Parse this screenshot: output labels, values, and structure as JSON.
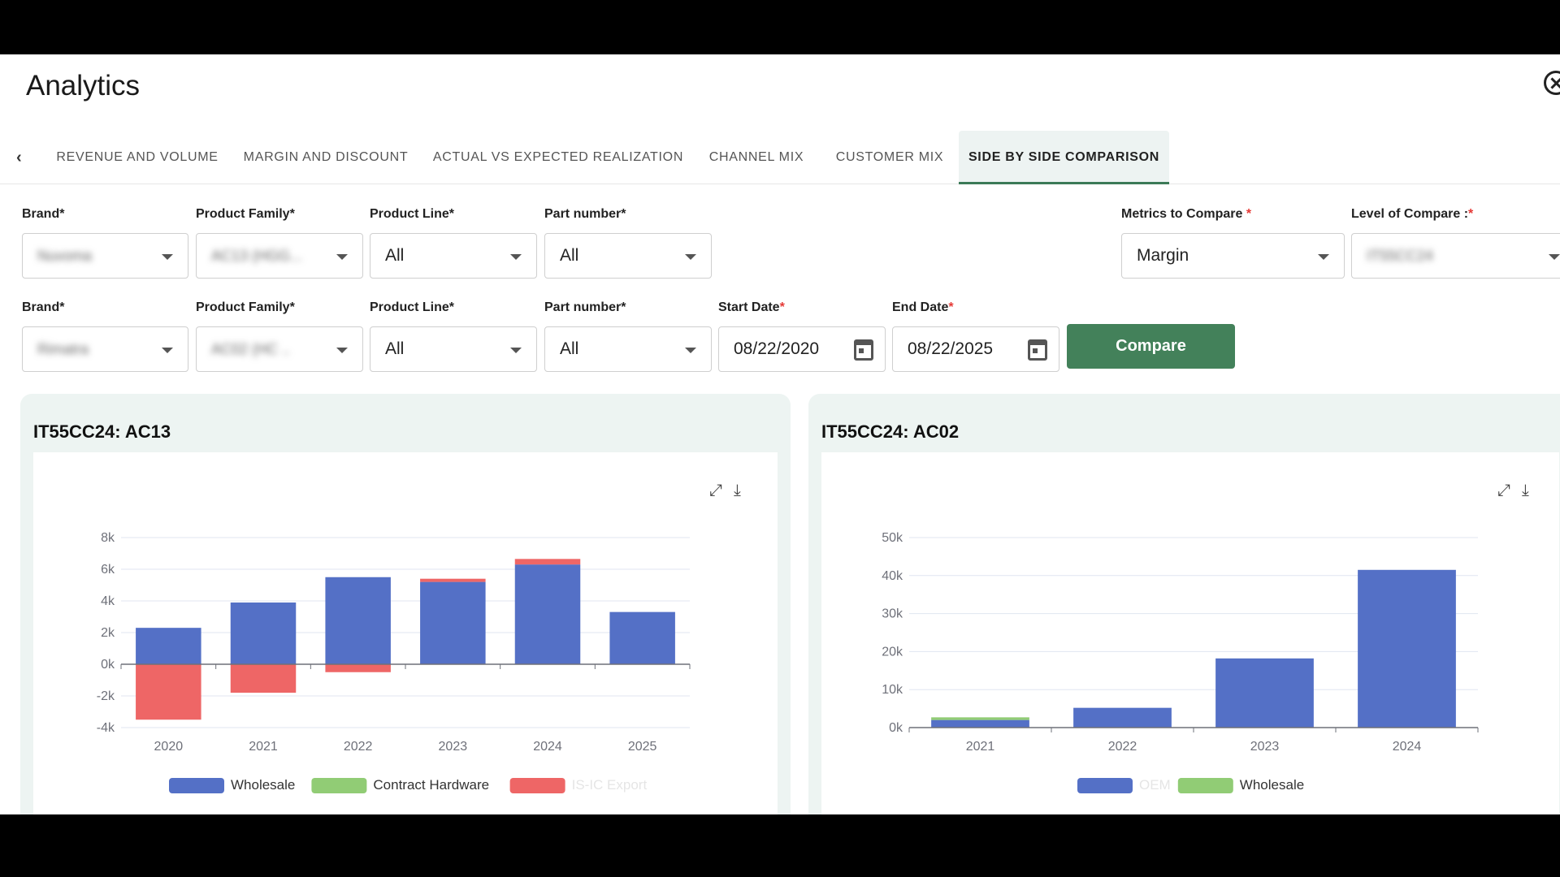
{
  "app": {
    "title": "Analytics"
  },
  "tabs": [
    {
      "label": "REVENUE AND VOLUME"
    },
    {
      "label": "MARGIN AND DISCOUNT"
    },
    {
      "label": "ACTUAL VS EXPECTED REALIZATION"
    },
    {
      "label": "CHANNEL MIX"
    },
    {
      "label": "CUSTOMER MIX"
    },
    {
      "label": "SIDE BY SIDE COMPARISON",
      "active": true
    }
  ],
  "filters_row1": {
    "brand_label": "Brand*",
    "brand_value": "Nuvoma",
    "family_label": "Product Family*",
    "family_value": "AC13 (HGG...",
    "line_label": "Product Line*",
    "line_value": "All",
    "part_label": "Part number*",
    "part_value": "All",
    "metrics_label": "Metrics to Compare",
    "metrics_req": "*",
    "metrics_value": "Margin",
    "level_label": "Level of Compare :",
    "level_req": "*",
    "level_value": "IT55CC24"
  },
  "filters_row2": {
    "brand_label": "Brand*",
    "brand_value": "Rimatra",
    "family_label": "Product Family*",
    "family_value": "AC02 (HC ..",
    "line_label": "Product Line*",
    "line_value": "All",
    "part_label": "Part number*",
    "part_value": "All",
    "start_label": "Start Date",
    "start_req": "*",
    "start_value": "08/22/2020",
    "end_label": "End Date",
    "end_req": "*",
    "end_value": "08/22/2025",
    "compare_label": "Compare"
  },
  "colors": {
    "blue": "#5470c6",
    "green": "#91cc75",
    "red": "#ee6666",
    "accent": "#43815a"
  },
  "cards": [
    {
      "title": "IT55CC24: AC13"
    },
    {
      "title": "IT55CC24: AC02"
    }
  ],
  "chart_data": [
    {
      "type": "bar",
      "stacked": true,
      "categories": [
        "2020",
        "2021",
        "2022",
        "2023",
        "2024",
        "2025"
      ],
      "yticks": [
        "8k",
        "6k",
        "4k",
        "2k",
        "0k",
        "-2k",
        "-4k"
      ],
      "ylim": [
        -4000,
        8000
      ],
      "series": [
        {
          "name": "Wholesale",
          "color": "#5470c6",
          "values": [
            2300,
            3900,
            5500,
            5200,
            6300,
            3300
          ]
        },
        {
          "name": "Contract Hardware",
          "color": "#91cc75",
          "values": [
            0,
            0,
            0,
            0,
            0,
            0
          ]
        },
        {
          "name": "IS-IC Export",
          "color": "#ee6666",
          "values": [
            -3500,
            -1800,
            -500,
            200,
            350,
            0
          ]
        }
      ],
      "blurred_legend": [
        2
      ]
    },
    {
      "type": "bar",
      "stacked": true,
      "categories": [
        "2021",
        "2022",
        "2023",
        "2024"
      ],
      "yticks": [
        "50k",
        "40k",
        "30k",
        "20k",
        "10k",
        "0k"
      ],
      "ylim": [
        0,
        50000
      ],
      "series": [
        {
          "name": "OEM",
          "color": "#5470c6",
          "values": [
            2000,
            5200,
            18200,
            41500
          ]
        },
        {
          "name": "Wholesale",
          "color": "#91cc75",
          "values": [
            700,
            0,
            0,
            0
          ]
        }
      ],
      "blurred_legend": [
        0
      ]
    }
  ]
}
